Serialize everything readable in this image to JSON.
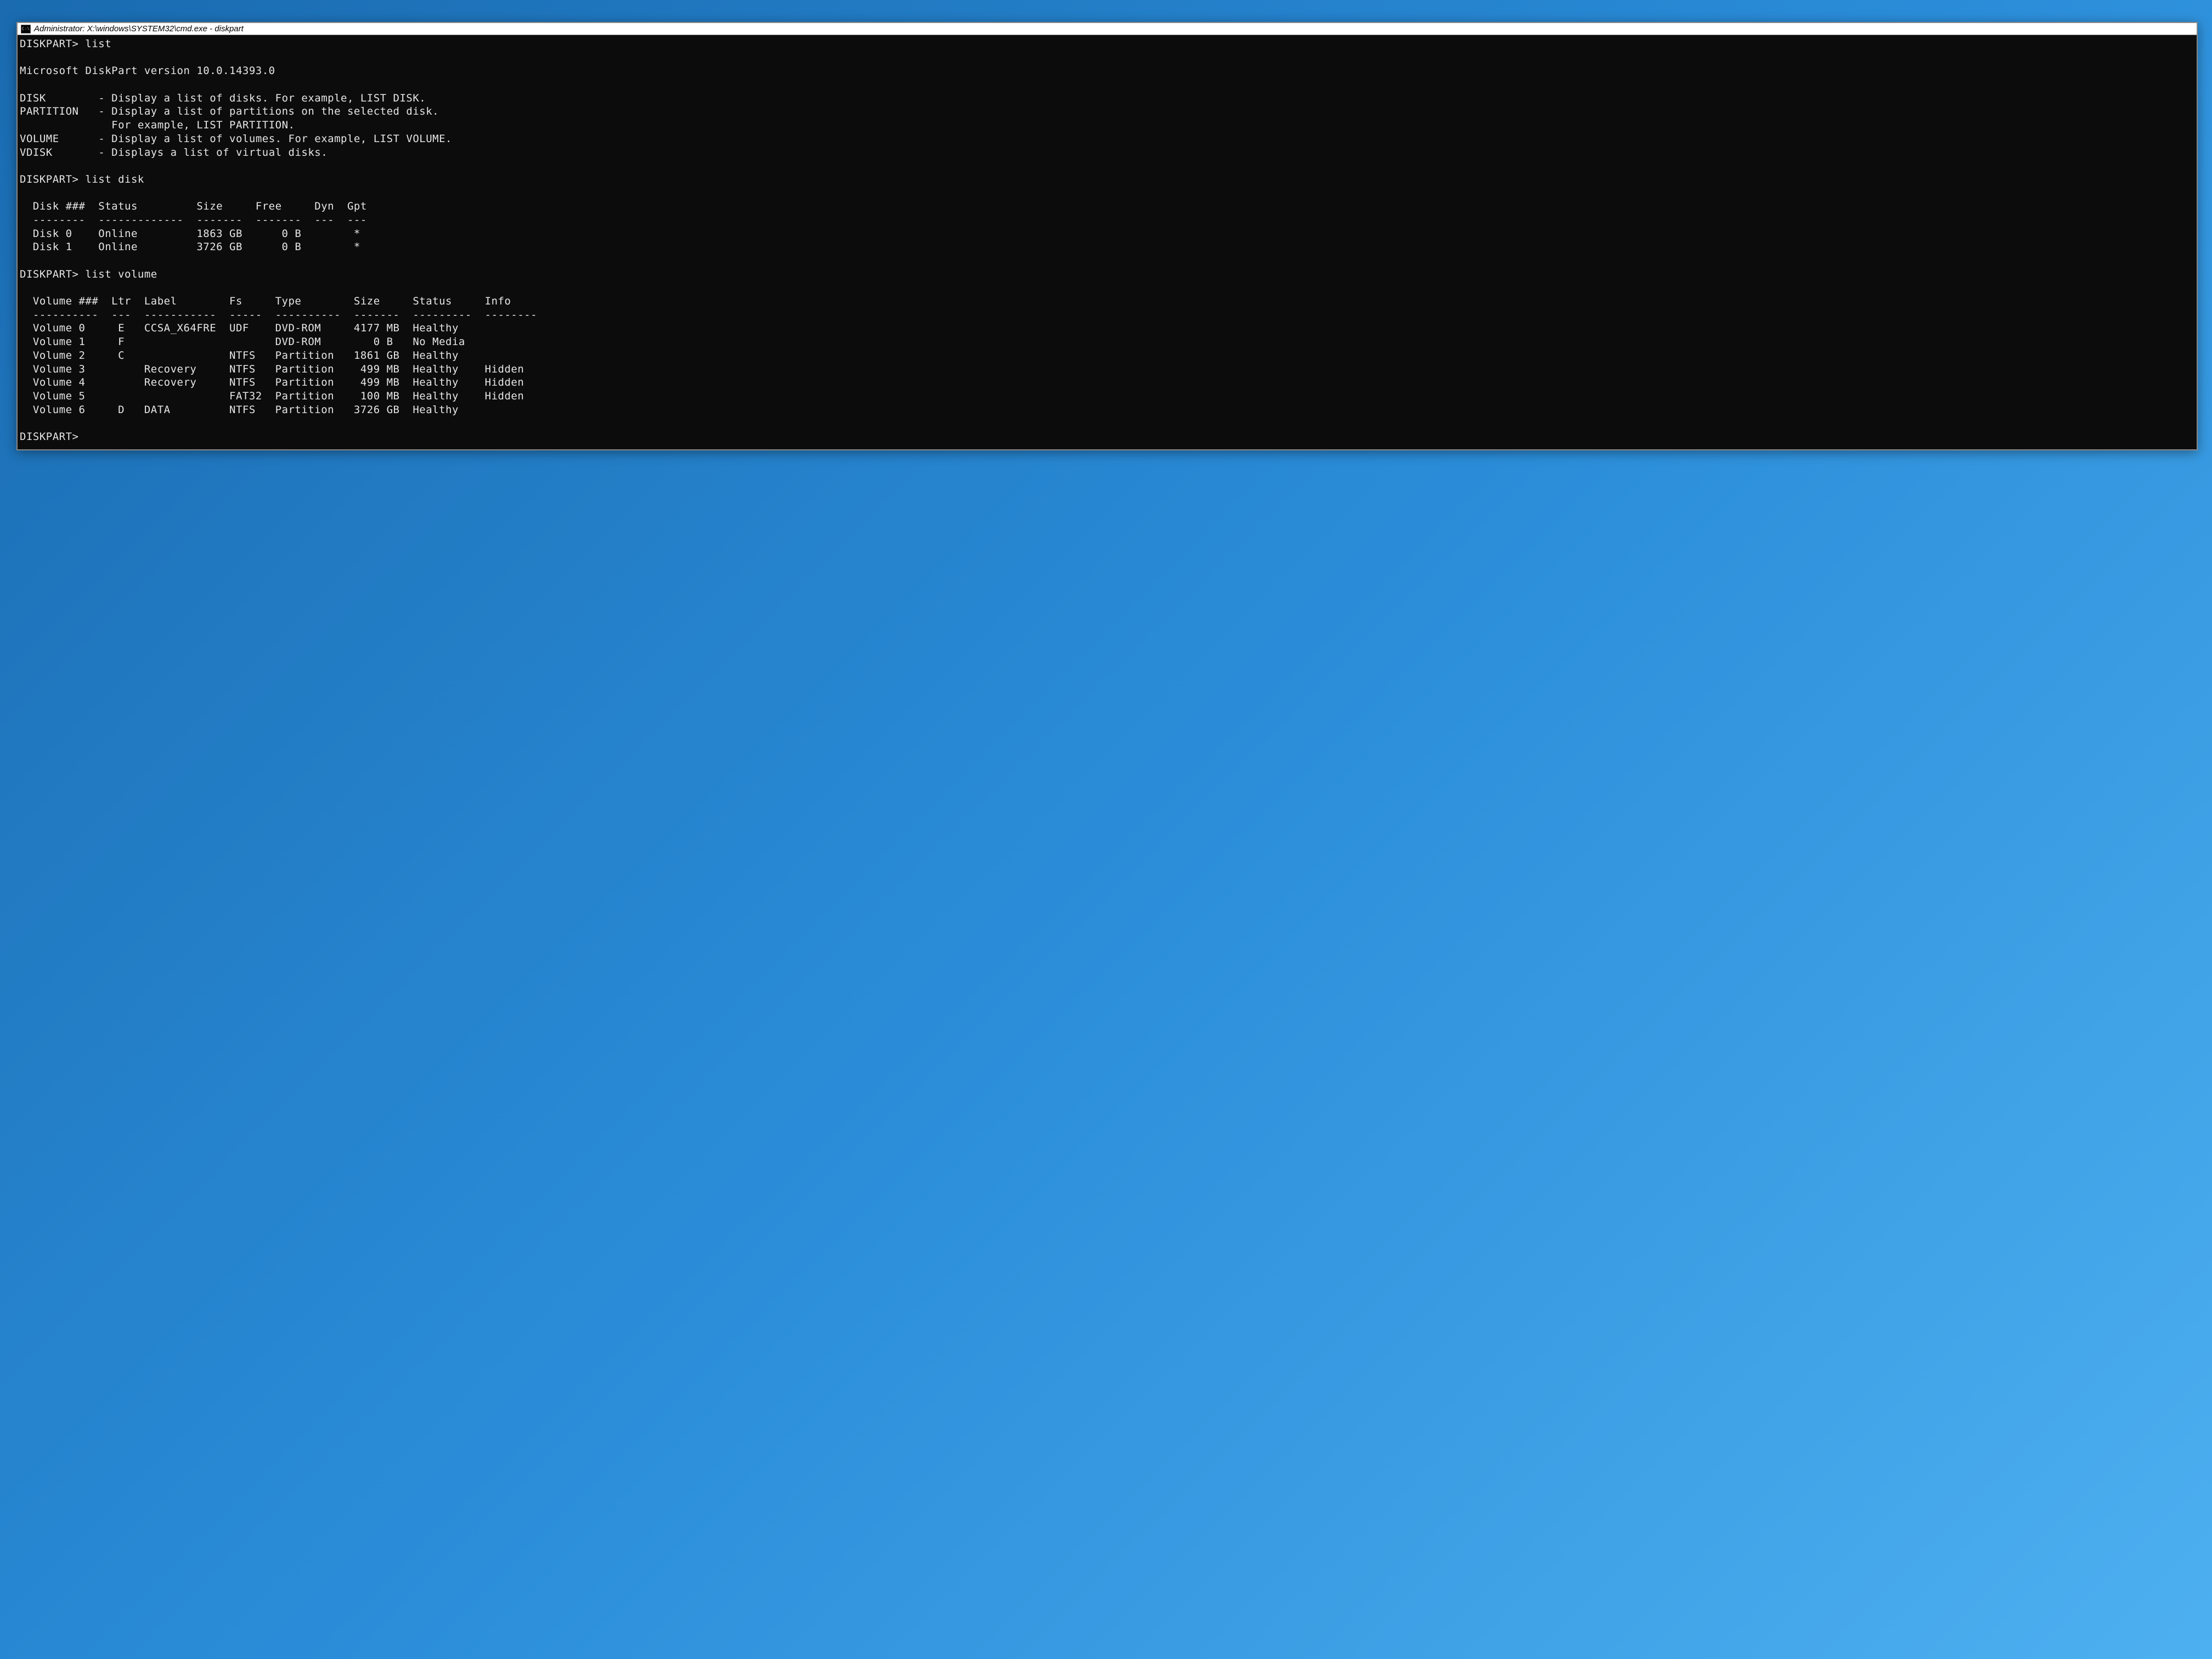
{
  "titlebar": {
    "icon": "C:\\",
    "text": "Administrator: X:\\windows\\SYSTEM32\\cmd.exe - diskpart"
  },
  "terminal": {
    "prompt": "DISKPART>",
    "cmd_list": "list",
    "version_line": "Microsoft DiskPart version 10.0.14393.0",
    "help": {
      "disk_k": "DISK",
      "disk_d": "- Display a list of disks. For example, LIST DISK.",
      "part_k": "PARTITION",
      "part_d1": "- Display a list of partitions on the selected disk.",
      "part_d2": "  For example, LIST PARTITION.",
      "vol_k": "VOLUME",
      "vol_d": "- Display a list of volumes. For example, LIST VOLUME.",
      "vdisk_k": "VDISK",
      "vdisk_d": "- Displays a list of virtual disks."
    },
    "cmd_list_disk": "list disk",
    "disk_header": "  Disk ###  Status         Size     Free     Dyn  Gpt",
    "disk_sep": "  --------  -------------  -------  -------  ---  ---",
    "disks": [
      "  Disk 0    Online         1863 GB      0 B        *",
      "  Disk 1    Online         3726 GB      0 B        *"
    ],
    "cmd_list_volume": "list volume",
    "vol_header": "  Volume ###  Ltr  Label        Fs     Type        Size     Status     Info",
    "vol_sep": "  ----------  ---  -----------  -----  ----------  -------  ---------  --------",
    "volumes": [
      "  Volume 0     E   CCSA_X64FRE  UDF    DVD-ROM     4177 MB  Healthy",
      "  Volume 1     F                       DVD-ROM        0 B   No Media",
      "  Volume 2     C                NTFS   Partition   1861 GB  Healthy",
      "  Volume 3         Recovery     NTFS   Partition    499 MB  Healthy    Hidden",
      "  Volume 4         Recovery     NTFS   Partition    499 MB  Healthy    Hidden",
      "  Volume 5                      FAT32  Partition    100 MB  Healthy    Hidden",
      "  Volume 6     D   DATA         NTFS   Partition   3726 GB  Healthy"
    ]
  }
}
